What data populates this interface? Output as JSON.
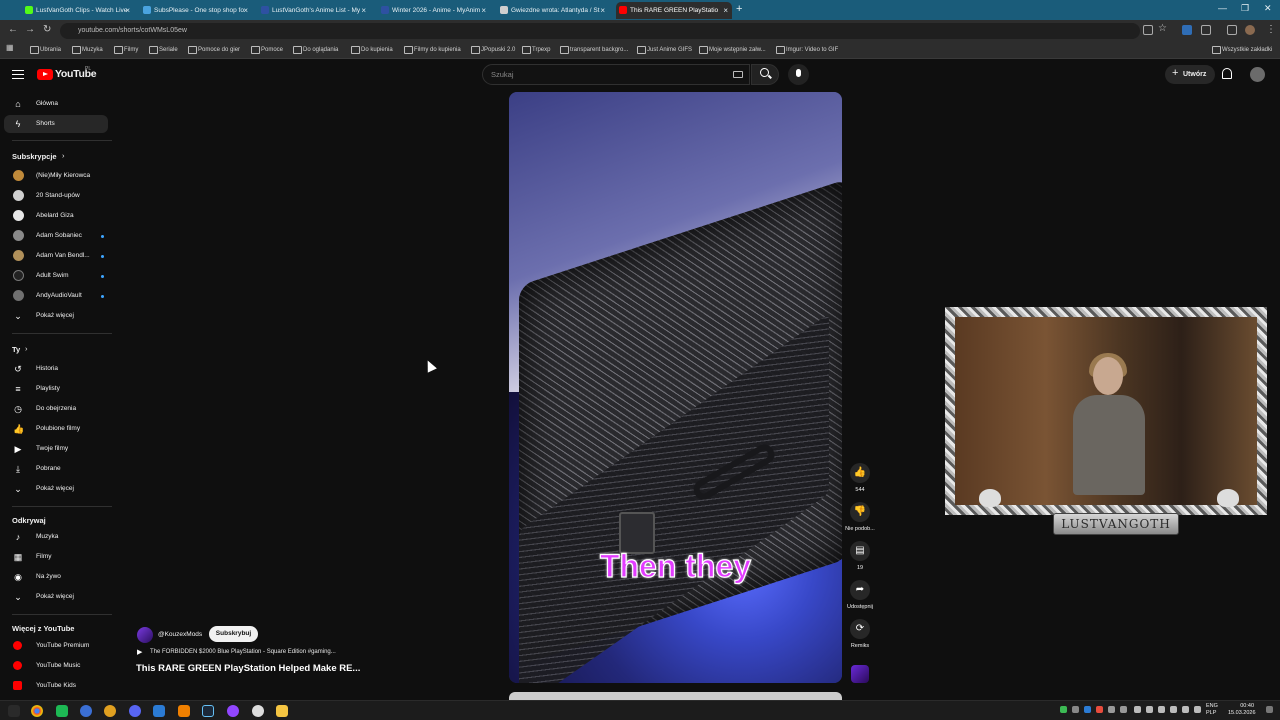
{
  "browser": {
    "tabs": [
      {
        "title": "LustVanGoth Clips - Watch Live",
        "color": "#53fc18"
      },
      {
        "title": "SubsPlease - One stop shop fo",
        "color": "#4aa3df"
      },
      {
        "title": "LustVanGoth's Anime List - My",
        "color": "#2e51a2"
      },
      {
        "title": "Winter 2026 - Anime - MyAnim",
        "color": "#2e51a2"
      },
      {
        "title": "Gwiezdne wrota: Atlantyda / St",
        "color": "#cfcfcf"
      },
      {
        "title": "This RARE GREEN PlayStatio",
        "color": "#ff0000"
      }
    ],
    "url": "youtube.com/shorts/cotWMsL05ew",
    "bookmarks": [
      "Ubrania",
      "Muzyka",
      "Filmy",
      "Seriale",
      "Pomoce do gier",
      "Pomoce",
      "Do oglądania",
      "Do kupienia",
      "Filmy do kupienia",
      "JPopuski 2.0",
      "Trpexp",
      "transparent backgro...",
      "Just Anime GIFS",
      "Moje wstępnie załw...",
      "Imgur: Video to GIF"
    ],
    "all_bookmarks": "Wszystkie zakładki"
  },
  "youtube": {
    "logo": "YouTube",
    "country": "PL",
    "search_placeholder": "Szukaj",
    "create_label": "Utwórz"
  },
  "sidebar": {
    "main": [
      {
        "label": "Główna",
        "icon": "home-icon",
        "glyph": "⌂"
      },
      {
        "label": "Shorts",
        "icon": "shorts-icon",
        "glyph": "ϟ"
      }
    ],
    "subs_header": "Subskrypcje",
    "subs": [
      {
        "label": "(Nie)Miły Kierowca",
        "color": "#c08a3a",
        "dot": false
      },
      {
        "label": "20 Stand-upów",
        "color": "#d0d0d0",
        "dot": false
      },
      {
        "label": "Abelard Giza",
        "color": "#e8e8e8",
        "dot": false
      },
      {
        "label": "Adam Sobaniec",
        "color": "#8a8a8a",
        "dot": true
      },
      {
        "label": "Adam Van Bendl...",
        "color": "#b0905a",
        "dot": true
      },
      {
        "label": "Adult Swim",
        "color": "#222222",
        "dot": true
      },
      {
        "label": "AndyAudioVault",
        "color": "#707070",
        "dot": true
      }
    ],
    "show_more": "Pokaż więcej",
    "you_header": "Ty",
    "you": [
      {
        "label": "Historia",
        "glyph": "↺"
      },
      {
        "label": "Playlisty",
        "glyph": "≡"
      },
      {
        "label": "Do obejrzenia",
        "glyph": "◷"
      },
      {
        "label": "Polubione filmy",
        "glyph": "👍"
      },
      {
        "label": "Twoje filmy",
        "glyph": "▶"
      },
      {
        "label": "Pobrane",
        "glyph": "⤓"
      }
    ],
    "show_more_2": "Pokaż więcej",
    "explore_header": "Odkrywaj",
    "explore": [
      {
        "label": "Muzyka",
        "glyph": "♪"
      },
      {
        "label": "Filmy",
        "glyph": "▦"
      },
      {
        "label": "Na żywo",
        "glyph": "◉"
      }
    ],
    "show_more_3": "Pokaż więcej",
    "more_header": "Więcej z YouTube",
    "more": [
      {
        "label": "YouTube Premium"
      },
      {
        "label": "YouTube Music"
      },
      {
        "label": "YouTube Kids"
      }
    ]
  },
  "short": {
    "caption": "Then they",
    "channel": "@KouzexMods",
    "subscribe": "Subskrybuj",
    "related": "The FORBIDDEN $2000 Blue PlayStation - Square Edition #gaming...",
    "title": "This RARE GREEN PlayStation Helped Make RE...",
    "actions": {
      "like_count": "544",
      "dislike_label": "Nie podob...",
      "comment_count": "19",
      "share_label": "Udostępnij",
      "remix_label": "Remiks"
    }
  },
  "overlay": {
    "nameplate": "LUSTVANGOTH"
  },
  "taskbar": {
    "lang1": "ENG",
    "lang2": "PLP",
    "time": "00:40",
    "date": "15.03.2026"
  }
}
